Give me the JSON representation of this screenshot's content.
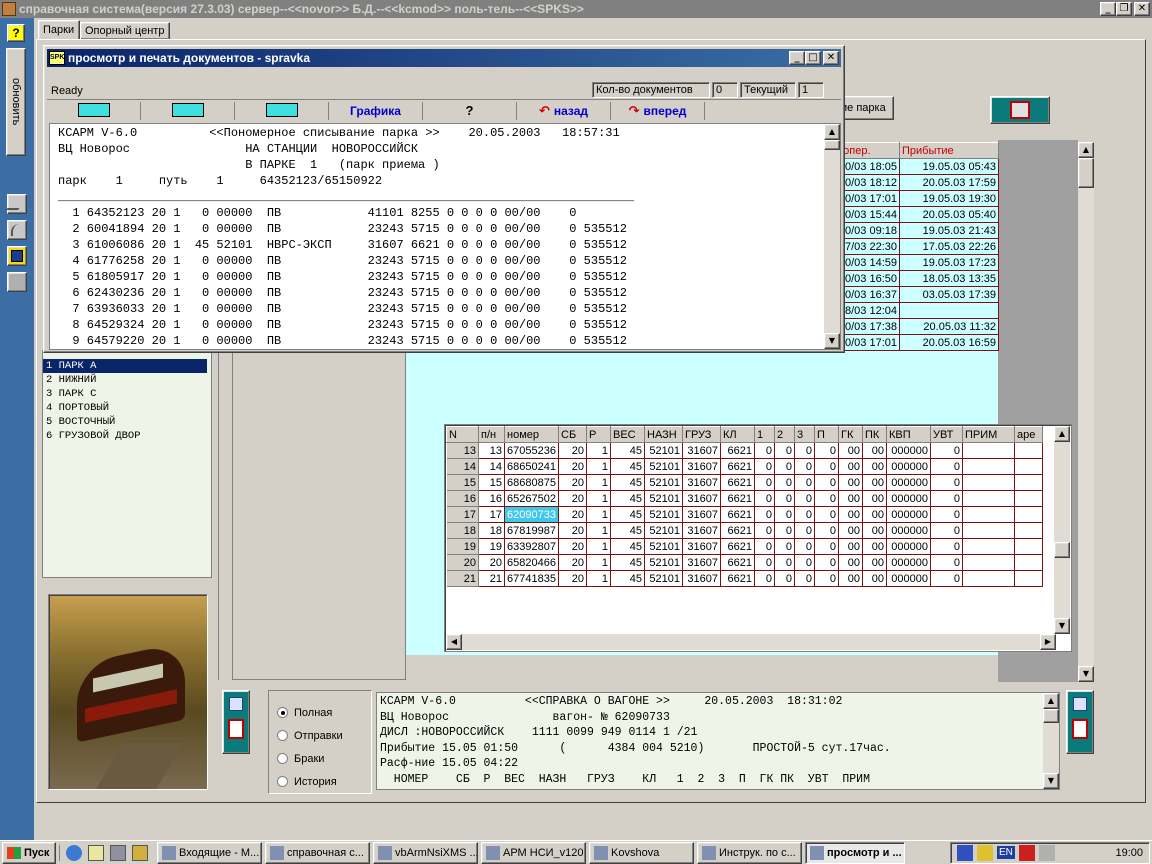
{
  "app": {
    "title": "справочная система(версия 27.3.03) сервер--<<novor>> Б.Д.--<<kcmod>> поль-тель--<<SPKS>>",
    "left_toolbar": {
      "help": "?",
      "refresh_label": "обновить"
    },
    "tabs": [
      "Парки",
      "Опорный центр"
    ],
    "behind_button": "ие парка"
  },
  "doc_window": {
    "title": "просмотр и печать документов - spravka",
    "status": "Ready",
    "count_label": "Кол-во документов",
    "count_value": "0",
    "current_label": "Текущий",
    "current_value": "1",
    "toolbar": {
      "graphics": "Графика",
      "help": "?",
      "back": "назад",
      "forward": "вперед"
    },
    "lines": [
      "КСАРМ V-6.0          <<Пономерное списывание парка >>    20.05.2003   18:57:31",
      "ВЦ Новорос                НА СТАНЦИИ  НОВОРОССИЙСК",
      "                          В ПАРКЕ  1   (парк приема )",
      "парк    1     путь    1     64352123/65150922",
      "",
      "________________________________________________________________________________",
      "  1 64352123 20 1   0 00000  ПВ            41101 8255 0 0 0 0 00/00    0",
      "  2 60041894 20 1   0 00000  ПВ            23243 5715 0 0 0 0 00/00    0 535512",
      "  3 61006086 20 1  45 52101  НВРС-ЭКСП     31607 6621 0 0 0 0 00/00    0 535512",
      "  4 61776258 20 1   0 00000  ПВ            23243 5715 0 0 0 0 00/00    0 535512",
      "  5 61805917 20 1   0 00000  ПВ            23243 5715 0 0 0 0 00/00    0 535512",
      "  6 62430236 20 1   0 00000  ПВ            23243 5715 0 0 0 0 00/00    0 535512",
      "  7 63936033 20 1   0 00000  ПВ            23243 5715 0 0 0 0 00/00    0 535512",
      "  8 64529324 20 1   0 00000  ПВ            23243 5715 0 0 0 0 00/00    0 535512",
      "  9 64579220 20 1   0 00000  ПВ            23243 5715 0 0 0 0 00/00    0 535512"
    ]
  },
  "parks": {
    "items": [
      "1  ПАРК А",
      "2  НИЖНИЙ",
      "3  ПАРК С",
      "4  ПОРТОВЫЙ",
      "5  ВОСТОЧНЫЙ",
      "6  ГРУЗОВОЙ ДВОР"
    ]
  },
  "ops_table": {
    "headers": [
      "ия опер.",
      "Прибытие"
    ],
    "rows": [
      [
        "0/03 18:05",
        "19.05.03 05:43"
      ],
      [
        "0/03 18:12",
        "20.05.03 17:59"
      ],
      [
        "0/03 17:01",
        "19.05.03 19:30"
      ],
      [
        "0/03 15:44",
        "20.05.03 05:40"
      ],
      [
        "0/03 09:18",
        "19.05.03 21:43"
      ],
      [
        "7/03 22:30",
        "17.05.03 22:26"
      ],
      [
        "0/03 14:59",
        "19.05.03 17:23"
      ],
      [
        "0/03 16:50",
        "18.05.03 13:35"
      ],
      [
        "0/03 16:37",
        "03.05.03 17:39"
      ],
      [
        "8/03 12:04",
        ""
      ],
      [
        "0/03 17:38",
        "20.05.03 11:32"
      ],
      [
        "0/03 17:01",
        "20.05.03 16:59"
      ]
    ]
  },
  "wagon_table": {
    "headers": [
      "N",
      "п/н",
      "номер",
      "СБ",
      "Р",
      "ВЕС",
      "НАЗН",
      "ГРУЗ",
      "КЛ",
      "1",
      "2",
      "3",
      "П",
      "ГК",
      "ПК",
      "КВП",
      "УВТ",
      "ПРИМ",
      "аре"
    ],
    "rows": [
      [
        "13",
        "13",
        "67055236",
        "20",
        "1",
        "45",
        "52101",
        "31607",
        "6621",
        "0",
        "0",
        "0",
        "0",
        "00",
        "00",
        "000000",
        "0"
      ],
      [
        "14",
        "14",
        "68650241",
        "20",
        "1",
        "45",
        "52101",
        "31607",
        "6621",
        "0",
        "0",
        "0",
        "0",
        "00",
        "00",
        "000000",
        "0"
      ],
      [
        "15",
        "15",
        "68680875",
        "20",
        "1",
        "45",
        "52101",
        "31607",
        "6621",
        "0",
        "0",
        "0",
        "0",
        "00",
        "00",
        "000000",
        "0"
      ],
      [
        "16",
        "16",
        "65267502",
        "20",
        "1",
        "45",
        "52101",
        "31607",
        "6621",
        "0",
        "0",
        "0",
        "0",
        "00",
        "00",
        "000000",
        "0"
      ],
      [
        "17",
        "17",
        "62090733",
        "20",
        "1",
        "45",
        "52101",
        "31607",
        "6621",
        "0",
        "0",
        "0",
        "0",
        "00",
        "00",
        "000000",
        "0"
      ],
      [
        "18",
        "18",
        "67819987",
        "20",
        "1",
        "45",
        "52101",
        "31607",
        "6621",
        "0",
        "0",
        "0",
        "0",
        "00",
        "00",
        "000000",
        "0"
      ],
      [
        "19",
        "19",
        "63392807",
        "20",
        "1",
        "45",
        "52101",
        "31607",
        "6621",
        "0",
        "0",
        "0",
        "0",
        "00",
        "00",
        "000000",
        "0"
      ],
      [
        "20",
        "20",
        "65820466",
        "20",
        "1",
        "45",
        "52101",
        "31607",
        "6621",
        "0",
        "0",
        "0",
        "0",
        "00",
        "00",
        "000000",
        "0"
      ],
      [
        "21",
        "21",
        "67741835",
        "20",
        "1",
        "45",
        "52101",
        "31607",
        "6621",
        "0",
        "0",
        "0",
        "0",
        "00",
        "00",
        "000000",
        "0"
      ]
    ],
    "selected_number": "62090733"
  },
  "radio": {
    "options": [
      "Полная",
      "Отправки",
      "Браки",
      "История"
    ],
    "selected": 0
  },
  "info": {
    "lines": [
      "КСАРМ V-6.0          <<СПРАВКА О ВАГОНЕ >>     20.05.2003  18:31:02",
      "ВЦ Новорос               вагон- № 62090733",
      "ДИСЛ :НОВОРОССИЙСК    1111 0099 949 0114 1 /21",
      "Прибытие 15.05 01:50      (      4384 004 5210)       ПРОСТОЙ-5 сут.17час.",
      "Расф-ние 15.05 04:22",
      "  НОМЕР    СБ  Р  ВЕС  НАЗН   ГРУЗ    КЛ   1  2  3  П  ГК ПК  УВТ  ПРИМ"
    ]
  },
  "taskbar": {
    "start": "Пуск",
    "tasks": [
      "Входящие - М...",
      "справочная с...",
      "vbArmNsiXMS ...",
      "АРМ НСИ_v120",
      "Kovshova",
      "Инструк. по с...",
      "просмотр и ..."
    ],
    "active": 6,
    "tray_lang": "EN",
    "clock": "19:00"
  },
  "colors": {
    "title_blue": "#0a246a",
    "grid_line": "#7a1010",
    "cyan": "#ccffff",
    "panel_green": "#eef5e8",
    "selected_bg": "#0a246a",
    "info_bg": "#eef5e8",
    "toolbar_text_blue": "#0000cc",
    "nav_red": "#cc0000"
  }
}
